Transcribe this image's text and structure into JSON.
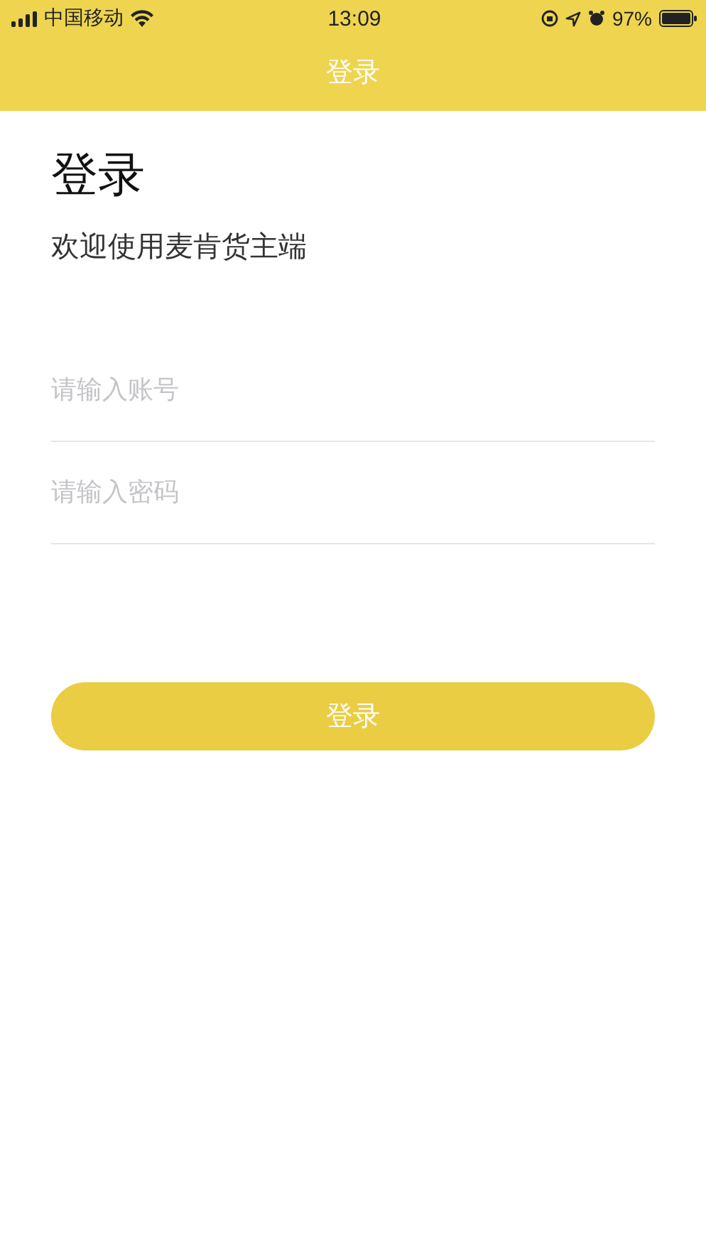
{
  "status_bar": {
    "carrier": "中国移动",
    "time": "13:09",
    "battery": "97%"
  },
  "nav_bar": {
    "title": "登录"
  },
  "heading": "登录",
  "subtitle": "欢迎使用麦肯货主端",
  "fields": [
    {
      "placeholder": "请输入账号"
    },
    {
      "placeholder": "请输入密码"
    }
  ],
  "login_button": "登录"
}
